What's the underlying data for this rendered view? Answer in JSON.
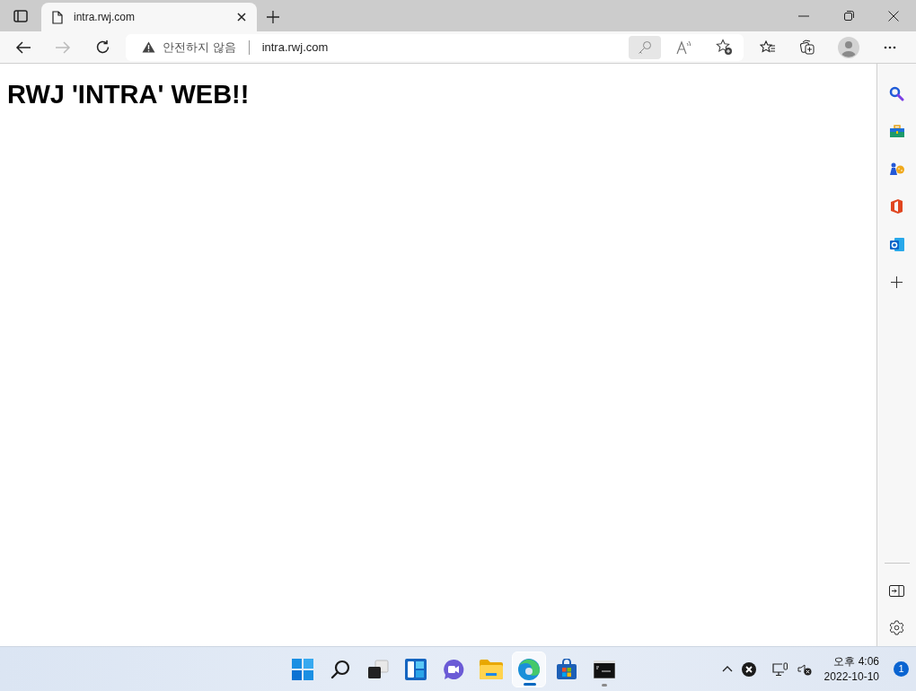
{
  "tab": {
    "title": "intra.rwj.com"
  },
  "address_bar": {
    "warning": "안전하지 않음",
    "url": "intra.rwj.com"
  },
  "page": {
    "heading": "RWJ 'INTRA' WEB!!"
  },
  "taskbar": {
    "apps": [
      {
        "kind": "start",
        "selected": false,
        "running": false
      },
      {
        "kind": "search",
        "selected": false,
        "running": false
      },
      {
        "kind": "taskview",
        "selected": false,
        "running": false
      },
      {
        "kind": "widgets",
        "selected": false,
        "running": false
      },
      {
        "kind": "chat",
        "selected": false,
        "running": false
      },
      {
        "kind": "explorer",
        "selected": false,
        "running": false
      },
      {
        "kind": "edge",
        "selected": true,
        "running": true
      },
      {
        "kind": "store",
        "selected": false,
        "running": false
      },
      {
        "kind": "terminal",
        "selected": false,
        "running": true
      }
    ],
    "clock": {
      "time": "오후 4:06",
      "date": "2022-10-10"
    },
    "notifications": "1"
  }
}
